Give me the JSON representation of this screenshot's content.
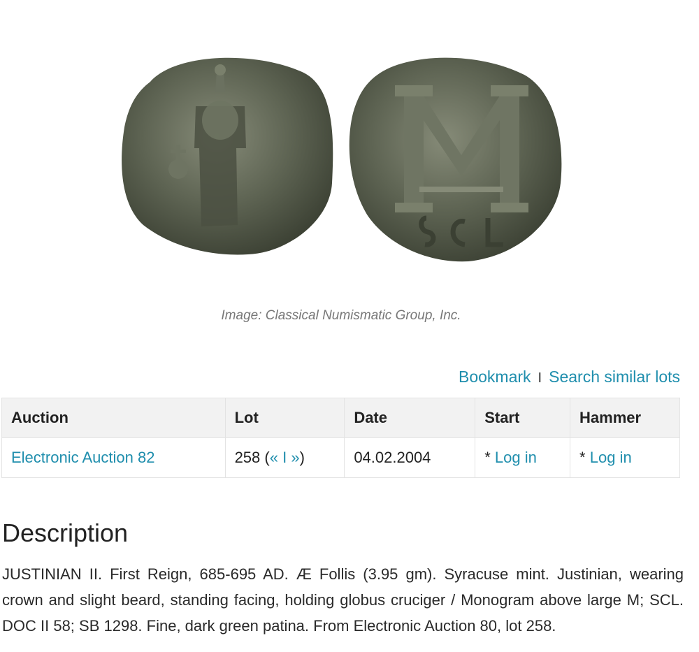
{
  "image": {
    "alt": "Byzantine follis of Justinian II, obverse and reverse",
    "caption": "Image: Classical Numismatic Group, Inc.",
    "colors": {
      "coin_dark": "#3b4033",
      "coin_mid": "#5d6352",
      "coin_light": "#868b78"
    }
  },
  "actions": {
    "bookmark": "Bookmark",
    "separator": "I",
    "search_similar": "Search similar lots"
  },
  "table": {
    "headers": {
      "auction": "Auction",
      "lot": "Lot",
      "date": "Date",
      "start": "Start",
      "hammer": "Hammer"
    },
    "row": {
      "auction": "Electronic Auction 82",
      "lot_number": "258",
      "lot_open": "(",
      "lot_prev": "«",
      "lot_sep": "I",
      "lot_next": "»",
      "lot_close": ")",
      "date": "04.02.2004",
      "start_prefix": "*",
      "start_link": "Log in",
      "hammer_prefix": "*",
      "hammer_link": "Log in"
    }
  },
  "description": {
    "title": "Description",
    "text": "JUSTINIAN II. First Reign, 685-695 AD. Æ Follis (3.95 gm). Syracuse mint. Justinian, wearing crown and slight beard, standing facing, holding globus cruciger / Monogram above large M; SCL. DOC II 58; SB 1298. Fine, dark green patina. From Electronic Auction 80, lot 258."
  },
  "theme": {
    "link_color": "#1f8ead",
    "header_bg": "#f2f2f2",
    "border_color": "#e3e3e3"
  }
}
